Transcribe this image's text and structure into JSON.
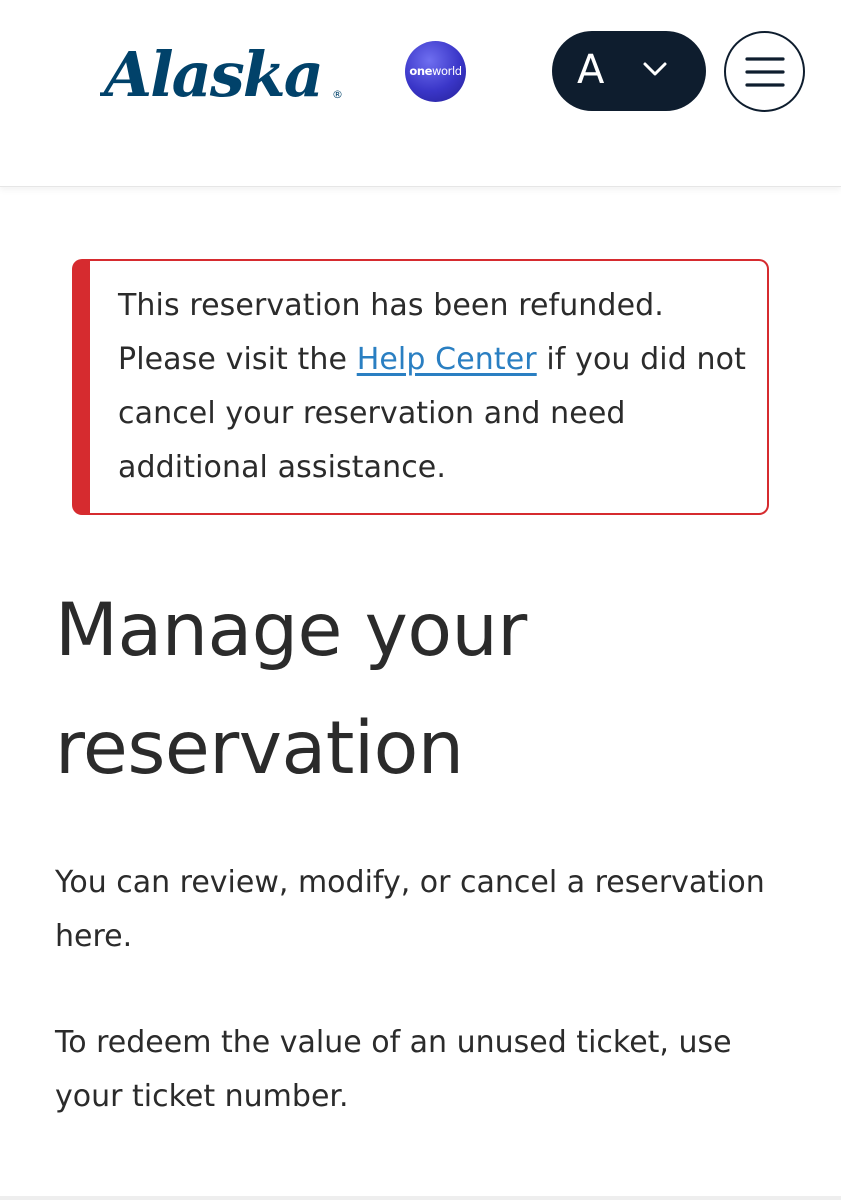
{
  "header": {
    "logo_text": "Alaska",
    "logo_mark": "®",
    "oneworld": {
      "bold": "one",
      "regular": "world"
    },
    "account_initial": "A",
    "account_chevron_icon": "chevron-down-icon",
    "menu_icon": "hamburger-menu-icon"
  },
  "alert": {
    "text_before": "This reservation has been refunded. Please visit the ",
    "link": "Help Center",
    "text_after": " if you did not cancel your reservation and need additional assistance.",
    "accent_color": "#d62b2f",
    "link_color": "#2a7fc2"
  },
  "main": {
    "title": "Manage your reservation",
    "intro_1": "You can review, modify, or cancel a reservation here.",
    "intro_2": "To redeem the value of an unused ticket, use your ticket number."
  },
  "colors": {
    "brand_navy": "#0e1d2e",
    "logo_navy": "#01426a",
    "text": "#2b2b2b"
  }
}
